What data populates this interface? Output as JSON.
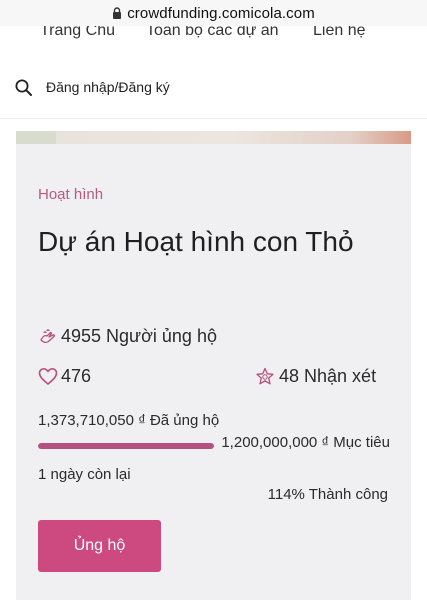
{
  "browser": {
    "url": "crowdfunding.comicola.com",
    "icons": {
      "lock": "lock-icon"
    }
  },
  "nav": {
    "items": [
      {
        "label": "Trang Chủ"
      },
      {
        "label": "Toàn bộ các dự án"
      },
      {
        "label": "Liên hệ"
      }
    ]
  },
  "header": {
    "login_label": "Đăng nhập/Đăng ký",
    "icons": {
      "search": "search-icon"
    }
  },
  "project": {
    "category": "Hoạt hình",
    "title": "Dự án Hoạt hình con Thỏ",
    "supporters": "4955 Người ủng hộ",
    "likes": "476",
    "reviews": "48 Nhận xét",
    "raised": "1,373,710,050 ₫ Đã ủng hộ",
    "goal": "1,200,000,000 ₫ Mục tiêu",
    "days_left": "1 ngày còn lại",
    "success": "114% Thành công",
    "progress_fraction": 1.0,
    "support_button_label": "Ủng hộ",
    "icons": {
      "supporters": "hands-icon",
      "likes": "heart-icon",
      "reviews": "star-badge-icon"
    }
  },
  "colors": {
    "accent": "#cd4a80",
    "category_text": "#b85a84",
    "card_background": "#f0eff1"
  }
}
